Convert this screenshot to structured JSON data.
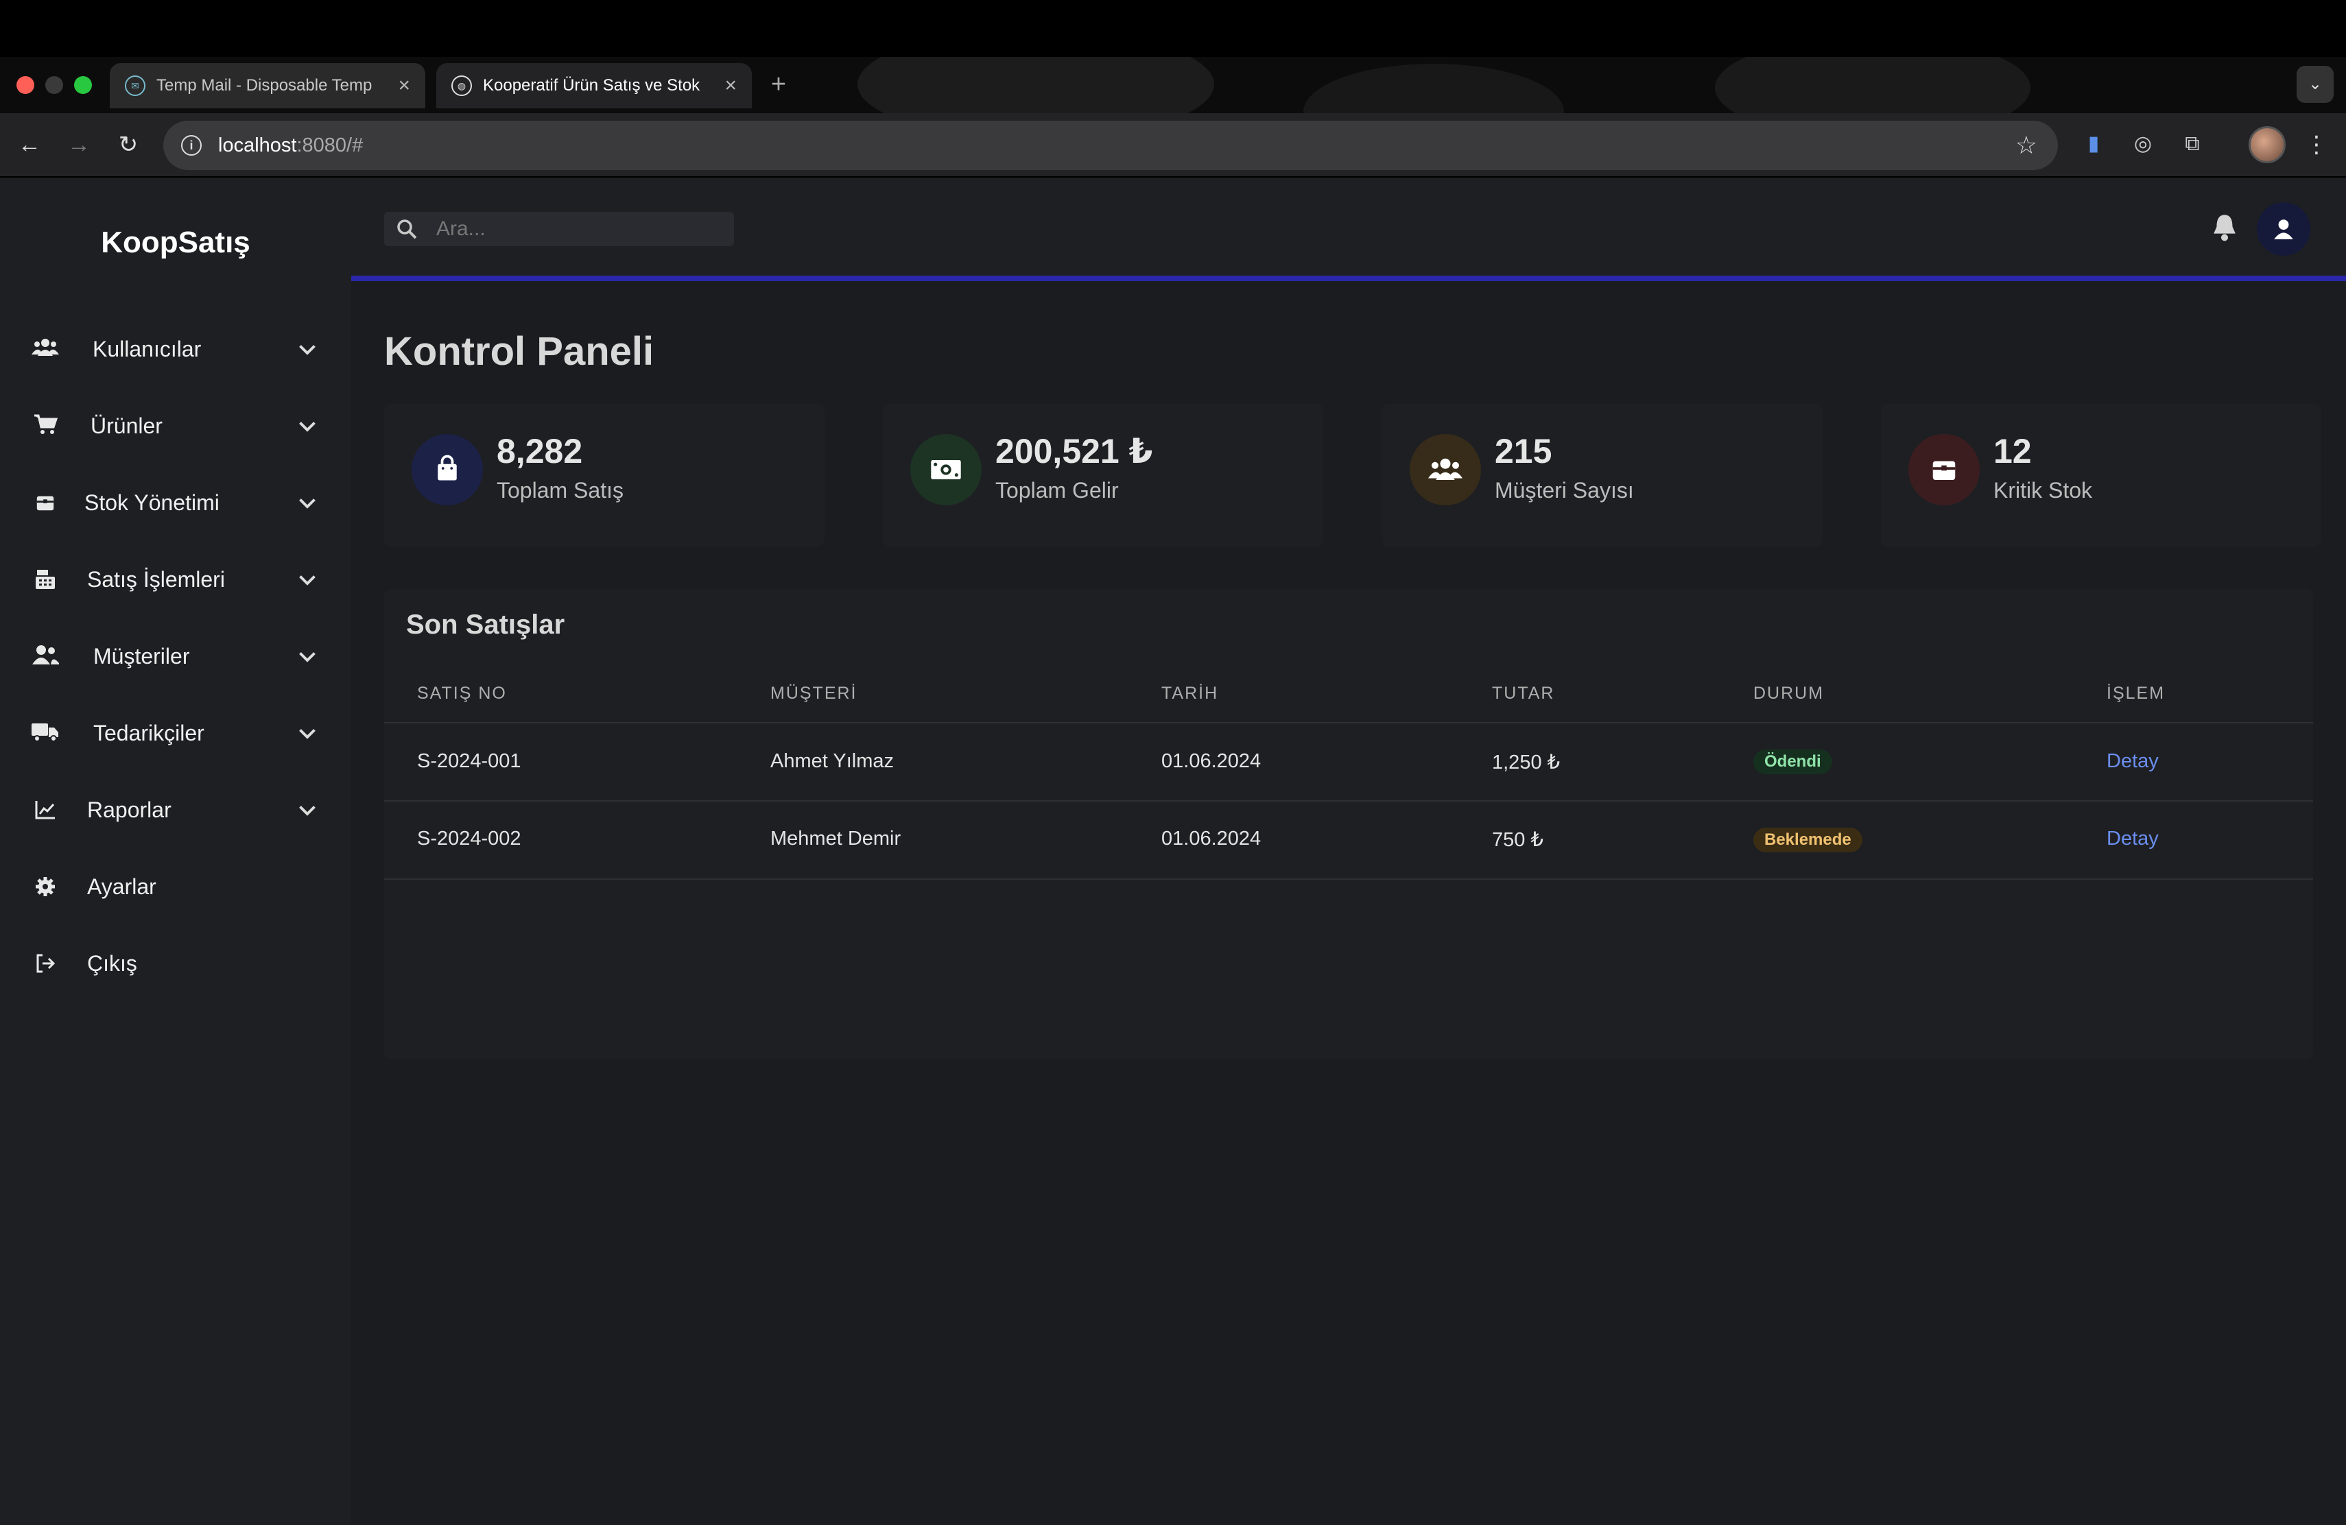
{
  "browser": {
    "tabs": [
      {
        "title": "Temp Mail - Disposable Temp",
        "active": false
      },
      {
        "title": "Kooperatif Ürün Satış ve Stok",
        "active": true
      }
    ],
    "url_host": "localhost",
    "url_path": ":8080/#"
  },
  "app": {
    "brand": "KoopSatış",
    "search_placeholder": "Ara...",
    "sidebar": {
      "items": [
        {
          "label": "Kullanıcılar",
          "icon": "users-icon",
          "has_submenu": true
        },
        {
          "label": "Ürünler",
          "icon": "cart-icon",
          "has_submenu": true
        },
        {
          "label": "Stok Yönetimi",
          "icon": "box-icon",
          "has_submenu": true
        },
        {
          "label": "Satış İşlemleri",
          "icon": "cash-register-icon",
          "has_submenu": true
        },
        {
          "label": "Müşteriler",
          "icon": "user-group-icon",
          "has_submenu": true
        },
        {
          "label": "Tedarikçiler",
          "icon": "truck-icon",
          "has_submenu": true
        },
        {
          "label": "Raporlar",
          "icon": "chart-line-icon",
          "has_submenu": true
        },
        {
          "label": "Ayarlar",
          "icon": "gear-icon",
          "has_submenu": false
        },
        {
          "label": "Çıkış",
          "icon": "logout-icon",
          "has_submenu": false
        }
      ]
    },
    "page_title": "Kontrol Paneli",
    "stats": [
      {
        "value": "8,282",
        "label": "Toplam Satış",
        "icon": "shopping-bag-icon",
        "color": "#1c2148",
        "icon_color": "#ffffff"
      },
      {
        "value": "200,521 ₺",
        "label": "Toplam Gelir",
        "icon": "money-icon",
        "color": "#1d3324",
        "icon_color": "#ffffff"
      },
      {
        "value": "215",
        "label": "Müşteri Sayısı",
        "icon": "users-icon",
        "color": "#372c19",
        "icon_color": "#ffffff"
      },
      {
        "value": "12",
        "label": "Kritik Stok",
        "icon": "box-icon",
        "color": "#3c1d1f",
        "icon_color": "#ffffff"
      }
    ],
    "recent_sales": {
      "title": "Son Satışlar",
      "columns": [
        "SATIŞ NO",
        "MÜŞTERİ",
        "TARİH",
        "TUTAR",
        "DURUM",
        "İŞLEM"
      ],
      "rows": [
        {
          "no": "S-2024-001",
          "customer": "Ahmet Yılmaz",
          "date": "01.06.2024",
          "amount": "1,250 ₺",
          "status": "Ödendi",
          "status_type": "paid",
          "action": "Detay"
        },
        {
          "no": "S-2024-002",
          "customer": "Mehmet Demir",
          "date": "01.06.2024",
          "amount": "750 ₺",
          "status": "Beklemede",
          "status_type": "pending",
          "action": "Detay"
        }
      ]
    },
    "colors": {
      "accent_bar": "#2b27a8",
      "link": "#6b8ff0",
      "paid_badge": "#8fe3a9",
      "pending_badge": "#f0c171"
    }
  }
}
